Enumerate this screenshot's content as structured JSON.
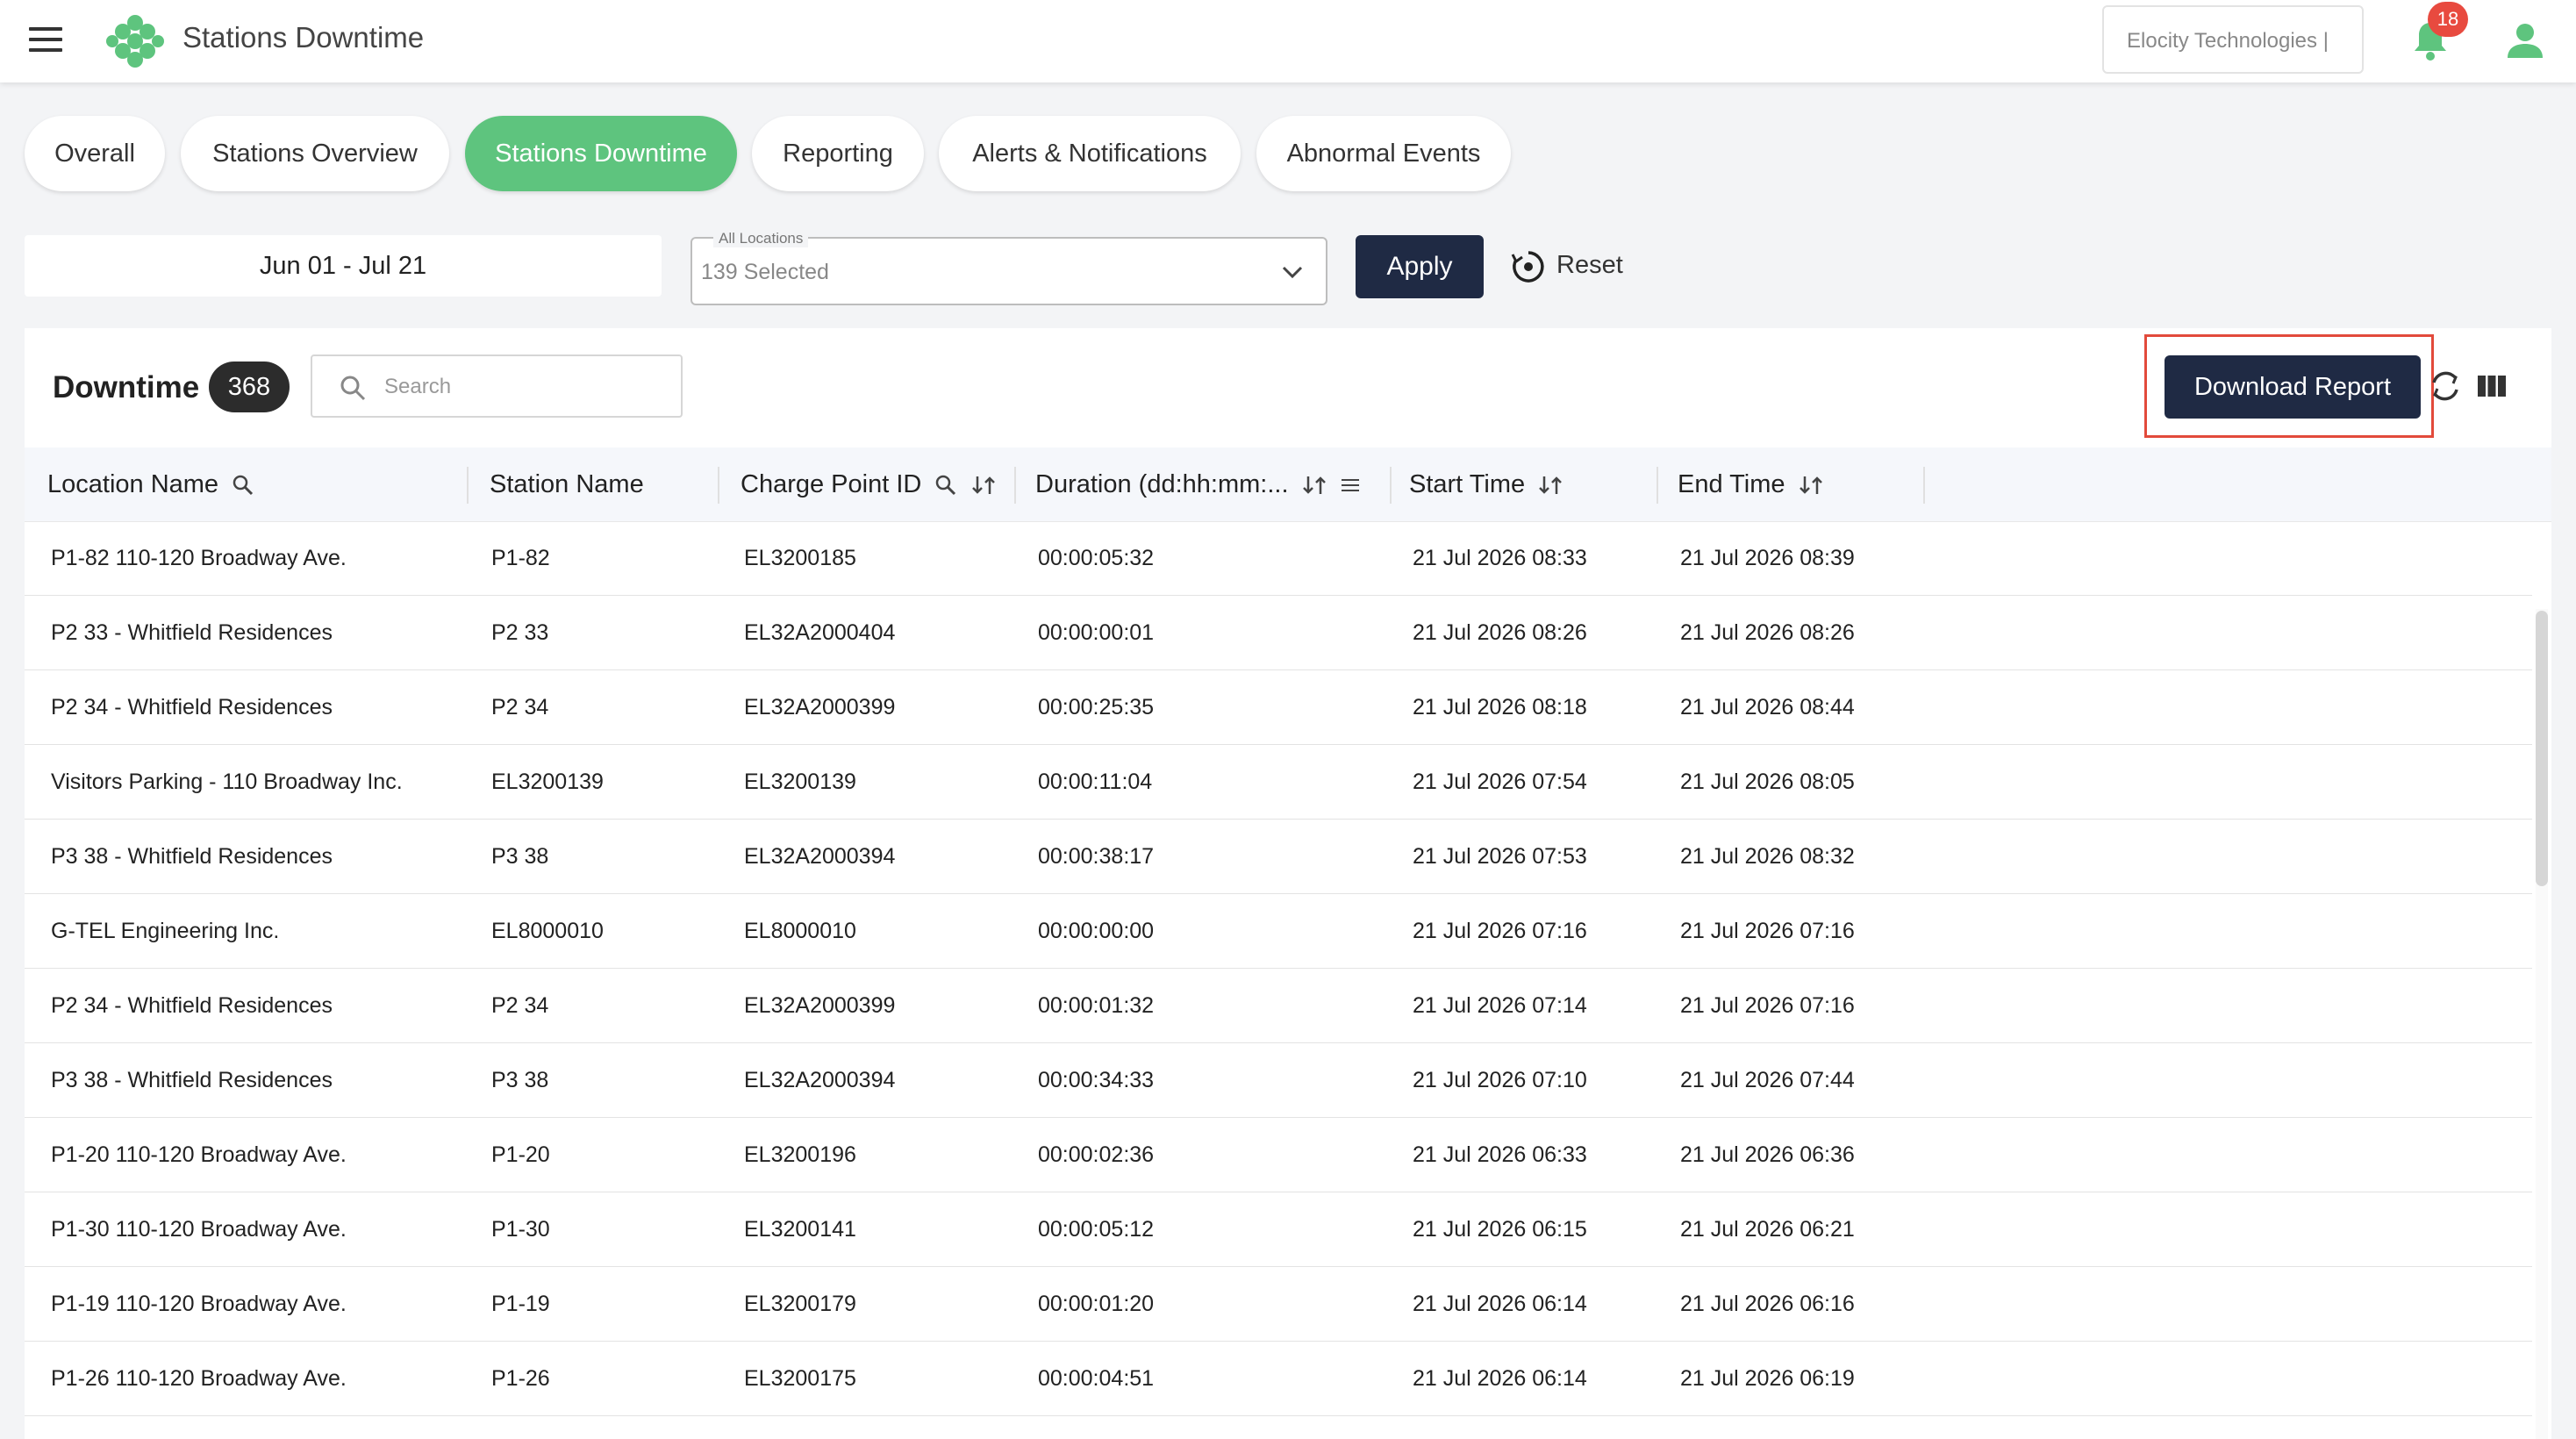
{
  "header": {
    "app_title": "Stations Downtime",
    "org_name": "Elocity Technologies |",
    "notification_count": "18",
    "brand_color": "#5ec47e"
  },
  "tabs": [
    {
      "label": "Overall",
      "active": false
    },
    {
      "label": "Stations Overview",
      "active": false
    },
    {
      "label": "Stations Downtime",
      "active": true
    },
    {
      "label": "Reporting",
      "active": false
    },
    {
      "label": "Alerts & Notifications",
      "active": false
    },
    {
      "label": "Abnormal Events",
      "active": false
    }
  ],
  "filters": {
    "date_range": "Jun 01 - Jul 21",
    "locations_label": "All Locations",
    "locations_value": "139 Selected",
    "apply_label": "Apply",
    "reset_label": "Reset"
  },
  "card": {
    "title": "Downtime",
    "count": "368",
    "search_placeholder": "Search",
    "download_label": "Download Report"
  },
  "table": {
    "headers": {
      "location": "Location Name",
      "station": "Station Name",
      "charge_point": "Charge Point ID",
      "duration": "Duration (dd:hh:mm:...",
      "start": "Start Time",
      "end": "End Time"
    },
    "rows": [
      {
        "location": "P1-82 110-120 Broadway Ave.",
        "station": "P1-82",
        "charge_point": "EL3200185",
        "duration": "00:00:05:32",
        "start": "21 Jul 2026 08:33",
        "end": "21 Jul 2026 08:39"
      },
      {
        "location": "P2 33 - Whitfield Residences",
        "station": "P2 33",
        "charge_point": "EL32A2000404",
        "duration": "00:00:00:01",
        "start": "21 Jul 2026 08:26",
        "end": "21 Jul 2026 08:26"
      },
      {
        "location": "P2 34 - Whitfield Residences",
        "station": "P2 34",
        "charge_point": "EL32A2000399",
        "duration": "00:00:25:35",
        "start": "21 Jul 2026 08:18",
        "end": "21 Jul 2026 08:44"
      },
      {
        "location": "Visitors Parking - 110 Broadway Inc.",
        "station": "EL3200139",
        "charge_point": "EL3200139",
        "duration": "00:00:11:04",
        "start": "21 Jul 2026 07:54",
        "end": "21 Jul 2026 08:05"
      },
      {
        "location": "P3 38 - Whitfield Residences",
        "station": "P3 38",
        "charge_point": "EL32A2000394",
        "duration": "00:00:38:17",
        "start": "21 Jul 2026 07:53",
        "end": "21 Jul 2026 08:32"
      },
      {
        "location": "G-TEL Engineering Inc.",
        "station": "EL8000010",
        "charge_point": "EL8000010",
        "duration": "00:00:00:00",
        "start": "21 Jul 2026 07:16",
        "end": "21 Jul 2026 07:16"
      },
      {
        "location": "P2 34 - Whitfield Residences",
        "station": "P2 34",
        "charge_point": "EL32A2000399",
        "duration": "00:00:01:32",
        "start": "21 Jul 2026 07:14",
        "end": "21 Jul 2026 07:16"
      },
      {
        "location": "P3 38 - Whitfield Residences",
        "station": "P3 38",
        "charge_point": "EL32A2000394",
        "duration": "00:00:34:33",
        "start": "21 Jul 2026 07:10",
        "end": "21 Jul 2026 07:44"
      },
      {
        "location": "P1-20 110-120 Broadway Ave.",
        "station": "P1-20",
        "charge_point": "EL3200196",
        "duration": "00:00:02:36",
        "start": "21 Jul 2026 06:33",
        "end": "21 Jul 2026 06:36"
      },
      {
        "location": "P1-30 110-120 Broadway Ave.",
        "station": "P1-30",
        "charge_point": "EL3200141",
        "duration": "00:00:05:12",
        "start": "21 Jul 2026 06:15",
        "end": "21 Jul 2026 06:21"
      },
      {
        "location": "P1-19 110-120 Broadway Ave.",
        "station": "P1-19",
        "charge_point": "EL3200179",
        "duration": "00:00:01:20",
        "start": "21 Jul 2026 06:14",
        "end": "21 Jul 2026 06:16"
      },
      {
        "location": "P1-26 110-120 Broadway Ave.",
        "station": "P1-26",
        "charge_point": "EL3200175",
        "duration": "00:00:04:51",
        "start": "21 Jul 2026 06:14",
        "end": "21 Jul 2026 06:19"
      }
    ]
  }
}
